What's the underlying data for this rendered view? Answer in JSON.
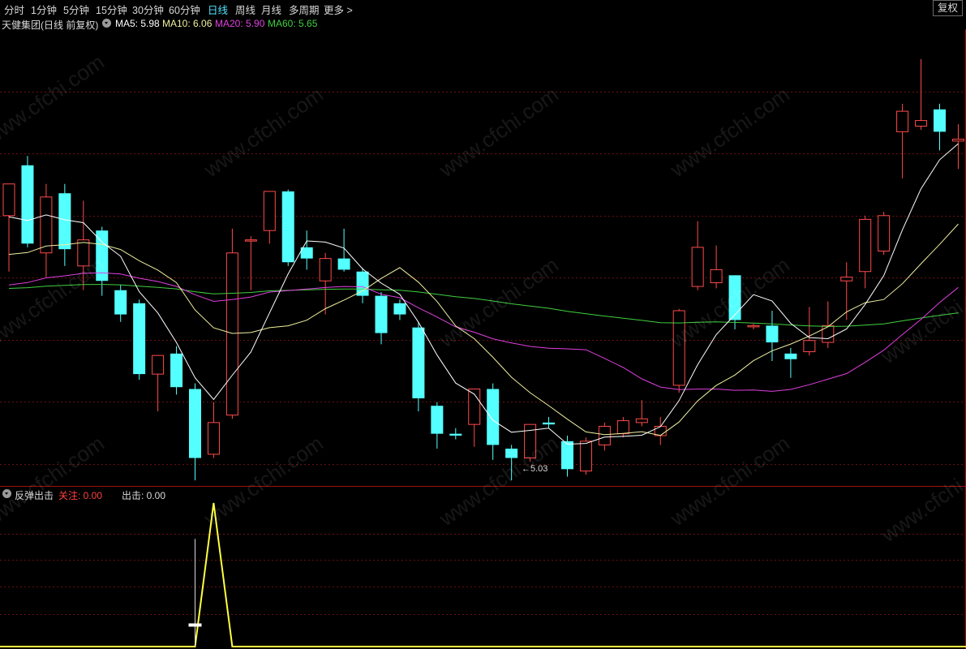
{
  "toolbar": {
    "periods": [
      {
        "label": "分时",
        "active": false
      },
      {
        "label": "1分钟",
        "active": false
      },
      {
        "label": "5分钟",
        "active": false
      },
      {
        "label": "15分钟",
        "active": false
      },
      {
        "label": "30分钟",
        "active": false
      },
      {
        "label": "60分钟",
        "active": false
      },
      {
        "label": "日线",
        "active": true
      },
      {
        "label": "周线",
        "active": false
      },
      {
        "label": "月线",
        "active": false
      },
      {
        "label": "多周期",
        "active": false
      },
      {
        "label": "更多 >",
        "active": false
      }
    ],
    "restore_label": "复权"
  },
  "main_legend": {
    "title": "天健集团(日线 前复权)",
    "ma5": "MA5: 5.98",
    "ma10": "MA10: 6.06",
    "ma20": "MA20: 5.90",
    "ma60": "MA60: 5.65"
  },
  "indicator_legend": {
    "name": "反弹出击",
    "focus": "关注: 0.00",
    "strike": "出击: 0.00"
  },
  "low_marker": "5.03",
  "watermark": "www.cfchi.com",
  "colors": {
    "up": "#ff4a4a",
    "down": "#54ffff",
    "ma5": "#ffffff",
    "ma10": "#f0f0a0",
    "ma20": "#e040e0",
    "ma60": "#40d040",
    "indicator": "#ffff40",
    "toolbar_active": "#4fe3ff"
  },
  "chart_data": {
    "type": "candlestick",
    "price_range": [
      5.0,
      7.45
    ],
    "candles": [
      {
        "o": 6.45,
        "h": 6.5,
        "l": 6.15,
        "c": 6.62
      },
      {
        "o": 6.72,
        "h": 6.77,
        "l": 6.28,
        "c": 6.3
      },
      {
        "o": 6.25,
        "h": 6.62,
        "l": 6.12,
        "c": 6.55
      },
      {
        "o": 6.57,
        "h": 6.62,
        "l": 6.18,
        "c": 6.27
      },
      {
        "o": 6.18,
        "h": 6.53,
        "l": 6.05,
        "c": 6.32
      },
      {
        "o": 6.37,
        "h": 6.39,
        "l": 6.02,
        "c": 6.1
      },
      {
        "o": 6.05,
        "h": 6.08,
        "l": 5.88,
        "c": 5.92
      },
      {
        "o": 5.98,
        "h": 6.0,
        "l": 5.57,
        "c": 5.6
      },
      {
        "o": 5.6,
        "h": 5.7,
        "l": 5.4,
        "c": 5.7
      },
      {
        "o": 5.71,
        "h": 5.75,
        "l": 5.49,
        "c": 5.53
      },
      {
        "o": 5.52,
        "h": 5.55,
        "l": 5.03,
        "c": 5.15
      },
      {
        "o": 5.17,
        "h": 5.45,
        "l": 5.15,
        "c": 5.34
      },
      {
        "o": 5.38,
        "h": 6.38,
        "l": 5.36,
        "c": 6.25
      },
      {
        "o": 6.32,
        "h": 6.34,
        "l": 6.05,
        "c": 6.32
      },
      {
        "o": 6.37,
        "h": 6.58,
        "l": 6.3,
        "c": 6.58
      },
      {
        "o": 6.58,
        "h": 6.59,
        "l": 6.18,
        "c": 6.2
      },
      {
        "o": 6.28,
        "h": 6.37,
        "l": 6.16,
        "c": 6.22
      },
      {
        "o": 6.1,
        "h": 6.25,
        "l": 5.92,
        "c": 6.22
      },
      {
        "o": 6.22,
        "h": 6.38,
        "l": 6.15,
        "c": 6.16
      },
      {
        "o": 6.15,
        "h": 6.17,
        "l": 5.98,
        "c": 6.02
      },
      {
        "o": 6.02,
        "h": 6.04,
        "l": 5.76,
        "c": 5.82
      },
      {
        "o": 5.98,
        "h": 6.0,
        "l": 5.89,
        "c": 5.92
      },
      {
        "o": 5.85,
        "h": 5.88,
        "l": 5.4,
        "c": 5.47
      },
      {
        "o": 5.43,
        "h": 5.45,
        "l": 5.2,
        "c": 5.28
      },
      {
        "o": 5.28,
        "h": 5.31,
        "l": 5.25,
        "c": 5.27
      },
      {
        "o": 5.33,
        "h": 5.37,
        "l": 5.21,
        "c": 5.52
      },
      {
        "o": 5.52,
        "h": 5.55,
        "l": 5.14,
        "c": 5.22
      },
      {
        "o": 5.2,
        "h": 5.22,
        "l": 5.03,
        "c": 5.15
      },
      {
        "o": 5.15,
        "h": 5.33,
        "l": 5.13,
        "c": 5.33
      },
      {
        "o": 5.34,
        "h": 5.37,
        "l": 5.31,
        "c": 5.33
      },
      {
        "o": 5.24,
        "h": 5.27,
        "l": 5.05,
        "c": 5.09
      },
      {
        "o": 5.08,
        "h": 5.26,
        "l": 5.06,
        "c": 5.24
      },
      {
        "o": 5.22,
        "h": 5.34,
        "l": 5.19,
        "c": 5.32
      },
      {
        "o": 5.28,
        "h": 5.37,
        "l": 5.26,
        "c": 5.35
      },
      {
        "o": 5.34,
        "h": 5.46,
        "l": 5.32,
        "c": 5.36
      },
      {
        "o": 5.27,
        "h": 5.37,
        "l": 5.22,
        "c": 5.32
      },
      {
        "o": 5.54,
        "h": 5.95,
        "l": 5.5,
        "c": 5.94
      },
      {
        "o": 6.07,
        "h": 6.42,
        "l": 6.05,
        "c": 6.28
      },
      {
        "o": 6.09,
        "h": 6.29,
        "l": 6.06,
        "c": 6.16
      },
      {
        "o": 6.13,
        "h": 6.1,
        "l": 5.84,
        "c": 5.89
      },
      {
        "o": 5.86,
        "h": 5.87,
        "l": 5.84,
        "c": 5.86
      },
      {
        "o": 5.86,
        "h": 5.94,
        "l": 5.67,
        "c": 5.77
      },
      {
        "o": 5.71,
        "h": 5.74,
        "l": 5.58,
        "c": 5.68
      },
      {
        "o": 5.72,
        "h": 5.96,
        "l": 5.7,
        "c": 5.78
      },
      {
        "o": 5.77,
        "h": 5.99,
        "l": 5.74,
        "c": 5.86
      },
      {
        "o": 6.1,
        "h": 6.2,
        "l": 5.89,
        "c": 6.12
      },
      {
        "o": 6.15,
        "h": 6.45,
        "l": 6.06,
        "c": 6.43
      },
      {
        "o": 6.26,
        "h": 6.47,
        "l": 6.24,
        "c": 6.45
      },
      {
        "o": 6.9,
        "h": 7.05,
        "l": 6.65,
        "c": 7.01
      },
      {
        "o": 6.93,
        "h": 7.29,
        "l": 6.91,
        "c": 6.96
      },
      {
        "o": 7.02,
        "h": 7.05,
        "l": 6.8,
        "c": 6.9
      },
      {
        "o": 6.85,
        "h": 6.94,
        "l": 6.7,
        "c": 6.86
      }
    ]
  },
  "indicator_data": {
    "type": "line",
    "range": [
      0,
      1
    ],
    "spike_index": 11,
    "spike_value": 1.0,
    "marker_index": 10,
    "marker_value": 0.15
  }
}
